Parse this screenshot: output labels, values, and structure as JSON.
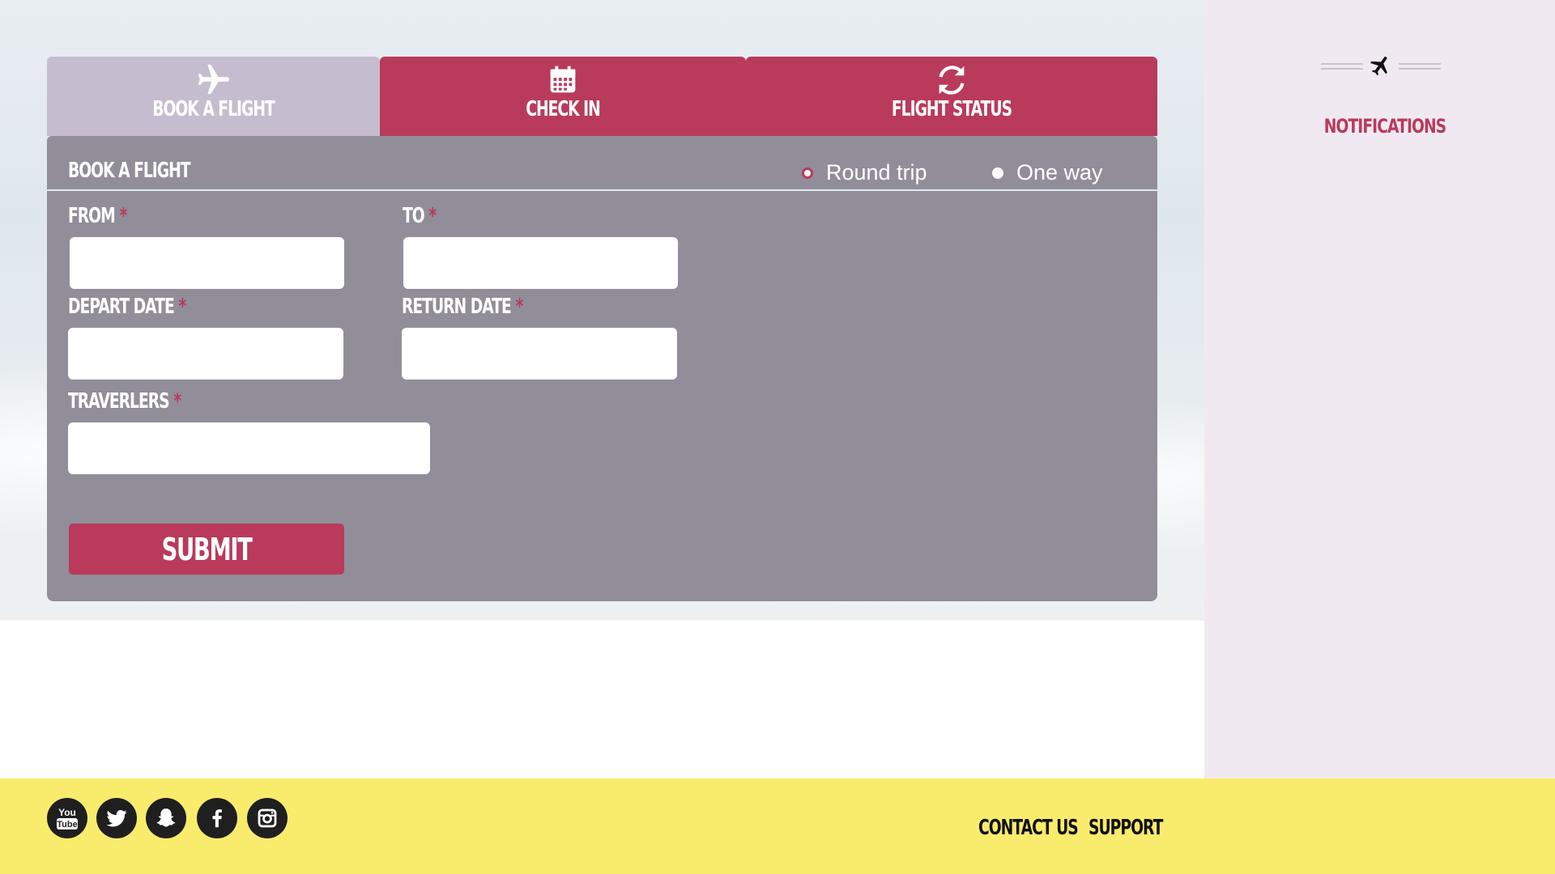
{
  "tabs": [
    {
      "label": "BOOK A FLIGHT",
      "icon": "airplane-icon",
      "active": true
    },
    {
      "label": "CHECK IN",
      "icon": "calendar-icon",
      "active": false
    },
    {
      "label": "FLIGHT STATUS",
      "icon": "refresh-icon",
      "active": false
    }
  ],
  "form": {
    "title": "BOOK A FLIGHT",
    "trip_options": [
      "Round trip",
      "One way"
    ],
    "selected_trip": "Round trip",
    "from_label": "FROM",
    "to_label": "TO",
    "depart_label": "DEPART DATE",
    "return_label": "RETURN DATE",
    "travelers_label": "TRAVERLERS",
    "required_mark": "*",
    "from_value": "",
    "to_value": "",
    "depart_value": "",
    "return_value": "",
    "travelers_value": "",
    "submit_label": "SUBMIT"
  },
  "sidebar": {
    "title": "NOTIFICATIONS",
    "icon": "airplane-icon"
  },
  "footer": {
    "social": [
      "youtube-icon",
      "twitter-icon",
      "snapchat-icon",
      "facebook-icon",
      "instagram-icon"
    ],
    "youtube_text_top": "You",
    "youtube_text_bottom": "Tube",
    "links": [
      "CONTACT US",
      "SUPPORT"
    ]
  },
  "colors": {
    "accent": "#b93a5b",
    "panel": "#918e9a",
    "active_tab": "#c6bccf",
    "sidebar": "#f1e9f1",
    "footer": "#f9ec6c"
  }
}
